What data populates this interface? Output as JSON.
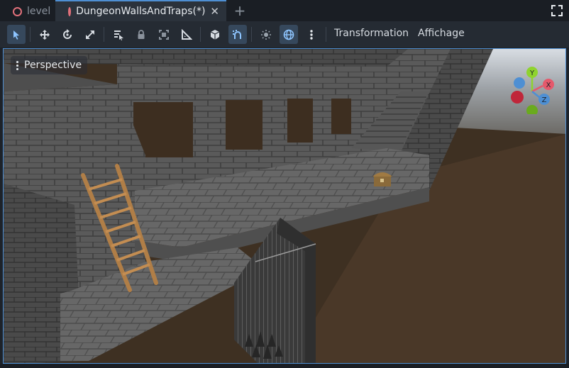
{
  "tabs": [
    {
      "label": "level",
      "active": false
    },
    {
      "label": "DungeonWallsAndTraps(*)",
      "active": true
    }
  ],
  "tab_close_glyph": "✕",
  "tab_add_glyph": "+",
  "toolbar": {
    "menus": [
      "Transformation",
      "Affichage"
    ],
    "tools": [
      "select-icon",
      "move-icon",
      "rotate-icon",
      "scale-icon",
      "list-select-icon",
      "lock-icon",
      "group-icon",
      "ruler-icon",
      "local-space-icon",
      "snap-icon",
      "sun-preview-icon",
      "environment-preview-icon",
      "more-options-icon"
    ],
    "active_tools": [
      "select-icon",
      "snap-icon",
      "environment-preview-icon"
    ]
  },
  "viewport": {
    "mode_label": "Perspective",
    "gizmo_axes": [
      "Y",
      "X",
      "Z"
    ]
  },
  "colors": {
    "accent": "#4e8fd3",
    "axis_x": "#e5596c",
    "axis_y": "#8fd32e",
    "axis_z": "#4e8fd3",
    "scene_icon": "#e0707a"
  }
}
